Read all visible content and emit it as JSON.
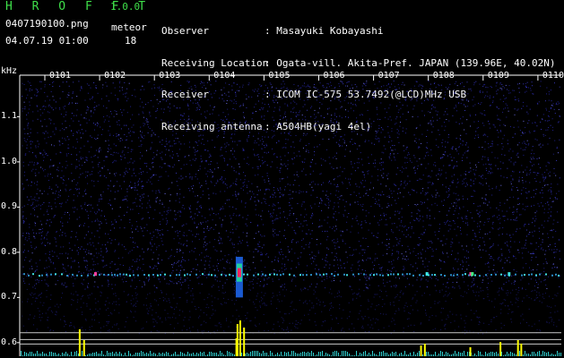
{
  "header": {
    "app_name": "H R O F F T",
    "version": "1.0.0",
    "filename": "0407190100.png",
    "datetime": "04.07.19 01:00",
    "meteor_label": "meteor",
    "meteor_count": "18"
  },
  "info": [
    {
      "key": "Observer",
      "sep": ":",
      "value": "Masayuki Kobayashi"
    },
    {
      "key": "Receiving Location",
      "sep": ":",
      "value": "Ogata-vill. Akita-Pref. JAPAN (139.96E, 40.02N)"
    },
    {
      "key": "Receiver",
      "sep": ":",
      "value": "ICOM IC-575 53.7492(@LCD)MHz USB"
    },
    {
      "key": "Receiving antenna",
      "sep": ":",
      "value": "A504HB(yagi 4el)"
    }
  ],
  "chart_data": {
    "type": "heatmap",
    "ylabel": "kHz",
    "y_ticks": [
      "1.1",
      "1.0",
      "0.9",
      "0.8",
      "0.7",
      "0.6"
    ],
    "x_ticks": [
      "0101",
      "0102",
      "0103",
      "0104",
      "0105",
      "0106",
      "0107",
      "0108",
      "0109",
      "0110"
    ],
    "ylim": [
      0.57,
      1.18
    ],
    "colors": {
      "background": "#000000",
      "noise": "#2a2a9a",
      "signal_line": "#20c0d0",
      "meteor": "#ffff00",
      "hot": "#ff2060"
    },
    "meteor_minutes": [
      1.62,
      4.52,
      4.58,
      7.85,
      8.75,
      9.3,
      9.65
    ]
  }
}
